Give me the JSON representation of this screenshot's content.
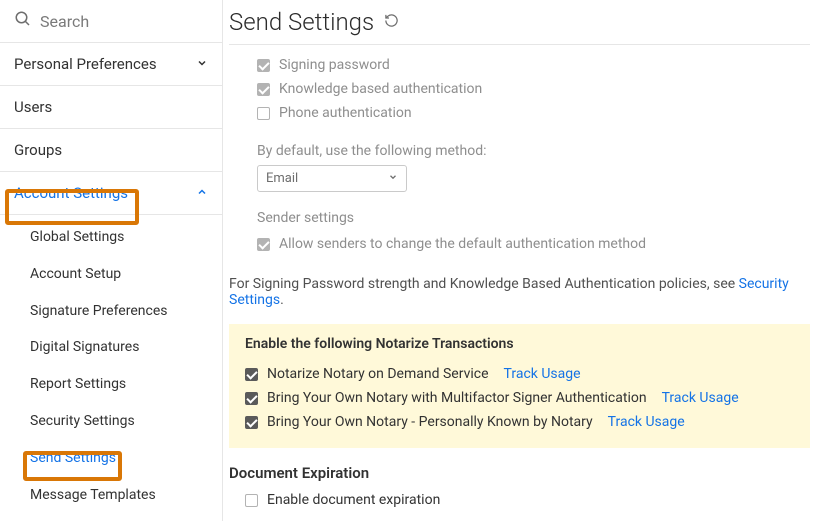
{
  "search": {
    "placeholder": "Search"
  },
  "sidebar": {
    "items": [
      {
        "label": "Personal Preferences",
        "expandable": true
      },
      {
        "label": "Users"
      },
      {
        "label": "Groups"
      },
      {
        "label": "Account Settings",
        "expandable": true,
        "expanded": true,
        "children": [
          {
            "label": "Global Settings"
          },
          {
            "label": "Account Setup"
          },
          {
            "label": "Signature Preferences"
          },
          {
            "label": "Digital Signatures"
          },
          {
            "label": "Report Settings"
          },
          {
            "label": "Security Settings"
          },
          {
            "label": "Send Settings",
            "active": true
          },
          {
            "label": "Message Templates"
          }
        ]
      }
    ]
  },
  "main": {
    "title": "Send Settings",
    "auth_options": [
      {
        "label": "Signing password",
        "checked": true
      },
      {
        "label": "Knowledge based authentication",
        "checked": true
      },
      {
        "label": "Phone authentication",
        "checked": false
      }
    ],
    "default_method_label": "By default, use the following method:",
    "default_method_value": "Email",
    "sender_settings_label": "Sender settings",
    "sender_allow_label": "Allow senders to change the default authentication method",
    "policy_text_prefix": "For Signing Password strength and Knowledge Based Authentication policies, see ",
    "policy_link_text": "Security Settings",
    "policy_text_suffix": ".",
    "notarize": {
      "title": "Enable the following Notarize Transactions",
      "rows": [
        {
          "label": "Notarize Notary on Demand Service",
          "link": "Track Usage"
        },
        {
          "label": "Bring Your Own Notary with Multifactor Signer Authentication",
          "link": "Track Usage"
        },
        {
          "label": "Bring Your Own Notary - Personally Known by Notary",
          "link": "Track Usage"
        }
      ]
    },
    "doc_expiration": {
      "heading": "Document Expiration",
      "enable_label": "Enable document expiration"
    }
  }
}
